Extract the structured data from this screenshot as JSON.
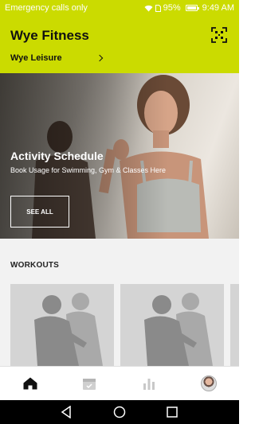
{
  "status_bar": {
    "carrier_text": "Emergency calls only",
    "battery_percent": "95%",
    "battery_level": 0.95,
    "time": "9:49 AM",
    "icons": [
      "wifi-icon",
      "sim-icon",
      "battery-icon"
    ]
  },
  "header": {
    "title": "Wye Fitness",
    "location": "Wye Leisure",
    "background_color": "#cbdb00",
    "scan_icon": "qr-scan-icon"
  },
  "hero": {
    "title": "Activity Schedule",
    "subtitle": "Book Usage for Swimming, Gym & Classes Here",
    "button_label": "SEE ALL"
  },
  "workouts": {
    "section_title": "WORKOUTS",
    "cards": [
      {
        "icon": "workout-placeholder-icon"
      },
      {
        "icon": "workout-placeholder-icon"
      },
      {
        "icon": "workout-placeholder-icon"
      }
    ]
  },
  "bottom_nav": {
    "items": [
      {
        "icon": "home-icon",
        "active": true
      },
      {
        "icon": "calendar-icon",
        "active": false
      },
      {
        "icon": "bar-chart-icon",
        "active": false
      },
      {
        "icon": "profile-avatar",
        "active": false
      }
    ]
  },
  "android_nav": {
    "buttons": [
      "back-icon",
      "home-circle-icon",
      "recents-icon"
    ]
  }
}
